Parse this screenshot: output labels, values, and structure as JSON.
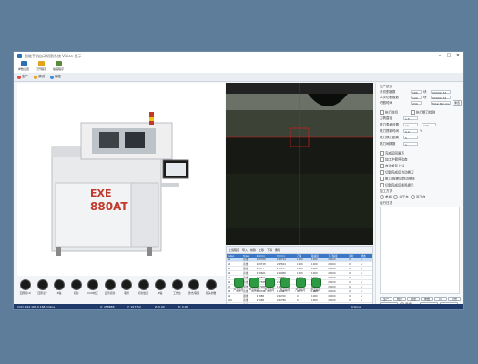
{
  "window": {
    "title": "智能手机自动切割系统   Vision 显示"
  },
  "toolbar": [
    {
      "label": "参数设置",
      "icon": "settings-icon",
      "color": "#2c6fb5"
    },
    {
      "label": "打开程序",
      "icon": "folder-icon",
      "color": "#e2a21b"
    },
    {
      "label": "编程程序",
      "icon": "edit-icon",
      "color": "#5a8a3a"
    }
  ],
  "tabs": [
    {
      "label": "生产",
      "icon": "play-icon",
      "color": "#e24a3b"
    },
    {
      "label": "调试",
      "icon": "debug-icon",
      "color": "#f0a020"
    },
    {
      "label": "编程",
      "icon": "program-icon",
      "color": "#3c8fd8"
    }
  ],
  "machine": {
    "brand": "EXE",
    "model": "880AT"
  },
  "panel": {
    "heading": "生产统计",
    "stats": [
      {
        "label": "总切割板数",
        "value": "186",
        "unit": "块",
        "value2": "00002434"
      },
      {
        "label": "本次切割板数",
        "value": "100",
        "unit": "块",
        "value2": "00002434"
      },
      {
        "label": "切割时间",
        "value": "230",
        "unit": "",
        "value2": "Total Nm:ms"
      }
    ],
    "section2": {
      "check1": "执行铣切",
      "check2": "执行断刀检测",
      "rows": [
        {
          "label": "刀具直径",
          "value": "1.5"
        },
        {
          "label": "铣刀寿命设置",
          "value": "10",
          "value2": "120"
        },
        {
          "label": "铣刀提前时间",
          "value": "0.0",
          "unit": "%"
        },
        {
          "label": "铣刀换刀距离",
          "value": "5"
        },
        {
          "label": "铣刀间隔数",
          "value": "1"
        }
      ]
    },
    "options": [
      "完成后回原点",
      "加工中暂停检查",
      "自动重复上料",
      "切割完成后自动换刀",
      "断刀/报警后自动继续",
      "切割完成后蜂鸣提示"
    ],
    "work_mode": {
      "label": "加工方式",
      "options": [
        "单板",
        "全平台",
        "双平台"
      ]
    },
    "log_label": "运行日志",
    "bottom_tabs": [
      "生产",
      "统计",
      "报警",
      "参数",
      "IO",
      "日志"
    ],
    "action_buttons": [
      "回原点",
      "单步",
      "启动",
      "暂停",
      "停止"
    ],
    "radio": [
      "连续",
      "单步"
    ],
    "big_buttons": [
      "启动",
      "暂停",
      "复位",
      "急停"
    ]
  },
  "table": {
    "toolbar": [
      "上载程序",
      "导入",
      "前移",
      "上移",
      "下移",
      "删除"
    ],
    "headers": [
      "Index",
      "Type",
      "X(mm)",
      "Y(mm)",
      "刀速",
      "轴速度",
      "下刀速度",
      "延时",
      "状态"
    ],
    "rows": [
      [
        "L1",
        "直线",
        "268788",
        "223744",
        "1000",
        "1000",
        "20000",
        "0",
        "✓"
      ],
      [
        "L2",
        "直线",
        "268728",
        "227844",
        "1000",
        "1000",
        "20000",
        "0",
        "✓"
      ],
      [
        "L3",
        "弧线",
        "28477",
        "277277",
        "1000",
        "1000",
        "20000",
        "0",
        "✓"
      ],
      [
        "L4",
        "直线",
        "218661",
        "219088",
        "1000",
        "1000",
        "20000",
        "0",
        "✓"
      ],
      [
        "L5",
        "直线",
        "219551",
        "229888",
        "1000",
        "1000",
        "20000",
        "0",
        "✓"
      ],
      [
        "L6",
        "直线",
        "217588",
        "21085",
        "1000",
        "1000",
        "20000",
        "0",
        "✓"
      ],
      [
        "L7",
        "弧线",
        "247988",
        "11485",
        "0",
        "1000",
        "20000",
        "0",
        "✓"
      ],
      [
        "L8",
        "直线",
        "268788",
        "11481",
        "0",
        "1000",
        "20000",
        "0",
        "✓"
      ],
      [
        "L9",
        "弧线",
        "27888",
        "221700",
        "0",
        "1000",
        "20000",
        "0",
        "✓"
      ],
      [
        "L10",
        "直线",
        "27668",
        "225786",
        "0",
        "1000",
        "20000",
        "0",
        "✓"
      ],
      [
        "L11",
        "直线",
        "27481",
        "225700",
        "0",
        "1000",
        "20000",
        "0",
        "✓"
      ],
      [
        "L12",
        "弧线",
        "27468",
        "225700",
        "0",
        "1000",
        "20000",
        "0",
        "✓"
      ]
    ]
  },
  "bottom_icons": [
    "回原点(X)",
    "回原点Y",
    "Z轴",
    "切割",
    "CCD校正",
    "显示切割",
    "吸附",
    "切割位置",
    "Z轴",
    "工作台",
    "激光/取图",
    "镜头补偿"
  ],
  "green_icons": [
    "产品编号",
    "产品编号",
    "产品编号",
    "产品编号",
    "产品编号",
    "产品编号"
  ],
  "statusbar": {
    "left": "CCD: 192.168.0.168 Online",
    "x": "X: 258888",
    "y": "Y: 197752",
    "z": "Z: 0.00",
    "w": "W: 0.00",
    "right": "Original"
  }
}
